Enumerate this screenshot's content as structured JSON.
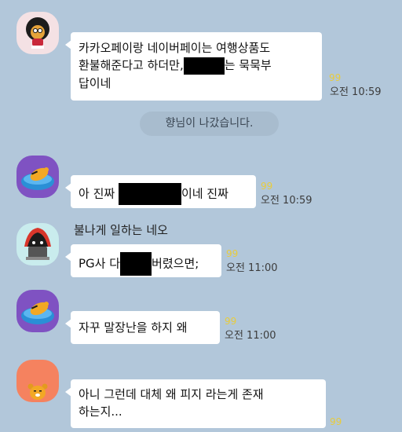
{
  "chat": {
    "messages": [
      {
        "lines": [
          [
            "카카오페이랑 네이버페이는 여행상품도"
          ],
          [
            " 환불해준다고 하더만,",
            "는 묵묵부"
          ],
          [
            "답이네"
          ]
        ],
        "unread": "99",
        "time": "오전 10:59"
      },
      {
        "lines": [
          [
            "아 진짜 ",
            "이네 진짜"
          ]
        ],
        "unread": "99",
        "time": "오전 10:59"
      },
      {
        "sender": "불나게 일하는 네오",
        "lines": [
          [
            "PG사 다",
            "버렸으면;"
          ]
        ],
        "unread": "99",
        "time": "오전 11:00"
      },
      {
        "lines": [
          [
            "자꾸 말장난을 하지 왜"
          ]
        ],
        "unread": "99",
        "time": "오전 11:00"
      },
      {
        "lines": [
          [
            "아니 그런데 대체 왜 피지 라는게 존재"
          ],
          [
            "하는지..."
          ]
        ],
        "unread": "99"
      }
    ],
    "notice": "향님이 나갔습니다."
  },
  "colors": {
    "background": "#b2c7da",
    "bubble": "#ffffff",
    "unread": "#e8cc3c",
    "notice_bg": "#a8bcce"
  }
}
